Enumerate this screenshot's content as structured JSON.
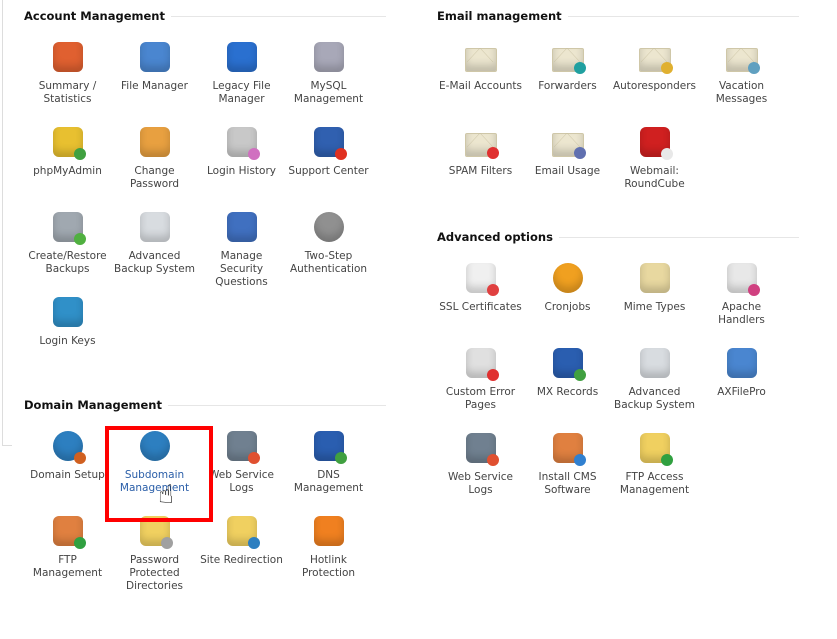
{
  "sections": [
    {
      "id": "account",
      "title": "Account Management",
      "items": [
        {
          "label": "Summary / Statistics",
          "icon": "statistics-chart-icon",
          "color": "#e06030"
        },
        {
          "label": "File Manager",
          "icon": "file-cabinet-icon",
          "color": "#4a86d0"
        },
        {
          "label": "Legacy File Manager",
          "icon": "legacy-file-box-icon",
          "color": "#2a70d0"
        },
        {
          "label": "MySQL Management",
          "icon": "database-icon",
          "color": "#a8a8b8"
        },
        {
          "label": "phpMyAdmin",
          "icon": "phpmyadmin-database-icon",
          "color": "#e8c030",
          "badge": "#40a040"
        },
        {
          "label": "Change Password",
          "icon": "padlock-icon",
          "color": "#e8a040"
        },
        {
          "label": "Login History",
          "icon": "login-history-icon",
          "color": "#c8c8c8",
          "badge": "#d070c0"
        },
        {
          "label": "Support Center",
          "icon": "support-book-icon",
          "color": "#3060b0",
          "badge": "#e03020"
        },
        {
          "label": "Create/Restore Backups",
          "icon": "backup-database-icon",
          "color": "#a0a8b0",
          "badge": "#50b040"
        },
        {
          "label": "Advanced Backup System",
          "icon": "backup-drive-icon",
          "color": "#d8dce0"
        },
        {
          "label": "Manage Security Questions",
          "icon": "security-shield-icon",
          "color": "#4070c0"
        },
        {
          "label": "Two-Step Authentication",
          "icon": "two-step-auth-icon",
          "color": "#909090",
          "round": true
        },
        {
          "label": "Login Keys",
          "icon": "login-key-icon",
          "color": "#3090c8"
        }
      ]
    },
    {
      "id": "domain",
      "title": "Domain Management",
      "items": [
        {
          "label": "Domain Setup",
          "icon": "globe-gear-icon",
          "color": "#2d7fc0",
          "round": true,
          "badge": "#d06020"
        },
        {
          "label": "Subdomain Management",
          "icon": "globe-icon",
          "color": "#2d7fc0",
          "round": true,
          "active": true
        },
        {
          "label": "Web Service Logs",
          "icon": "log-file-icon",
          "color": "#708090",
          "badge": "#e05030"
        },
        {
          "label": "DNS Management",
          "icon": "dns-network-icon",
          "color": "#2a5eb0",
          "badge": "#40a040"
        },
        {
          "label": "FTP Management",
          "icon": "ftp-folder-icon",
          "color": "#e08040",
          "badge": "#30a040"
        },
        {
          "label": "Password Protected Directories",
          "icon": "locked-folder-icon",
          "color": "#f0d060",
          "badge": "#a0a0a0"
        },
        {
          "label": "Site Redirection",
          "icon": "redirect-folder-icon",
          "color": "#f0d060",
          "badge": "#2d7fc0"
        },
        {
          "label": "Hotlink Protection",
          "icon": "hotlink-lock-icon",
          "color": "#f08020"
        }
      ]
    },
    {
      "id": "email",
      "title": "Email management",
      "items": [
        {
          "label": "E-Mail Accounts",
          "icon": "envelope-icon",
          "color": "#ece6cf",
          "env": true
        },
        {
          "label": "Forwarders",
          "icon": "forward-envelope-icon",
          "color": "#ece6cf",
          "env": true,
          "badge": "#20a0a0"
        },
        {
          "label": "Autoresponders",
          "icon": "autoresponder-envelope-icon",
          "color": "#ece6cf",
          "env": true,
          "badge": "#e0b030"
        },
        {
          "label": "Vacation Messages",
          "icon": "vacation-envelope-icon",
          "color": "#ece6cf",
          "env": true,
          "badge": "#60a0c0"
        },
        {
          "label": "SPAM Filters",
          "icon": "spam-filter-icon",
          "color": "#ece6cf",
          "env": true,
          "badge": "#e03030"
        },
        {
          "label": "Email Usage",
          "icon": "email-usage-icon",
          "color": "#ece6cf",
          "env": true,
          "badge": "#6070b0"
        },
        {
          "label": "Webmail: RoundCube",
          "icon": "roundcube-icon",
          "color": "#d02020",
          "badge": "#e8e8e8"
        }
      ]
    },
    {
      "id": "advanced",
      "title": "Advanced options",
      "items": [
        {
          "label": "SSL Certificates",
          "icon": "certificate-icon",
          "color": "#f0f0f0",
          "badge": "#e04040"
        },
        {
          "label": "Cronjobs",
          "icon": "clock-icon",
          "color": "#f0a020",
          "round": true
        },
        {
          "label": "Mime Types",
          "icon": "mime-types-icon",
          "color": "#e8d8a0"
        },
        {
          "label": "Apache Handlers",
          "icon": "apache-handlers-icon",
          "color": "#e8e8e8",
          "badge": "#d04080"
        },
        {
          "label": "Custom Error Pages",
          "icon": "error-page-icon",
          "color": "#e0e0e0",
          "badge": "#e03030"
        },
        {
          "label": "MX Records",
          "icon": "mx-records-icon",
          "color": "#2a5eb0",
          "badge": "#40a040"
        },
        {
          "label": "Advanced Backup System",
          "icon": "backup-drive-icon",
          "color": "#d8dce0"
        },
        {
          "label": "AXFilePro",
          "icon": "axfilepro-icon",
          "color": "#4a86d0"
        },
        {
          "label": "Web Service Logs",
          "icon": "log-file-icon",
          "color": "#708090",
          "badge": "#e05030"
        },
        {
          "label": "Install CMS Software",
          "icon": "install-cms-box-icon",
          "color": "#e08040",
          "badge": "#3080d0"
        },
        {
          "label": "FTP Access Management",
          "icon": "ftp-access-folder-icon",
          "color": "#f0d060",
          "badge": "#30a040"
        }
      ]
    }
  ],
  "highlight_color": "#ff0000"
}
